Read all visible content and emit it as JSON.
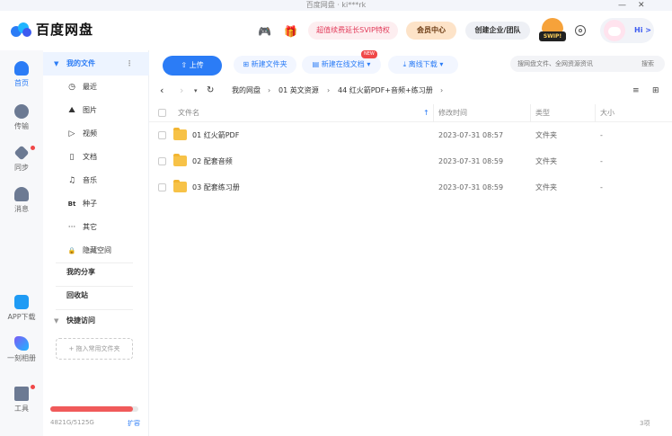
{
  "window": {
    "title": "百度网盘 · ki***rk",
    "minimize": "—",
    "close": "✕"
  },
  "header": {
    "brand": "百度网盘",
    "svip_label": "超值续费延长SVIP特权",
    "vip_center": "会员中心",
    "enterprise": "创建企业/团队",
    "badge": "SWIP!",
    "greeting": "Hi >"
  },
  "left_nav": [
    {
      "label": "首页"
    },
    {
      "label": "传输"
    },
    {
      "label": "同步"
    },
    {
      "label": "消息"
    },
    {
      "label": "APP下载"
    },
    {
      "label": "一刻相册"
    },
    {
      "label": "工具"
    }
  ],
  "tree": {
    "root_label": "我的文件",
    "items": [
      {
        "icon": "◷",
        "label": "最近"
      },
      {
        "icon": "⛰",
        "label": "图片"
      },
      {
        "icon": "▷",
        "label": "视频"
      },
      {
        "icon": "▯",
        "label": "文档"
      },
      {
        "icon": "♫",
        "label": "音乐"
      },
      {
        "icon": "Bt",
        "label": "种子"
      },
      {
        "icon": "···",
        "label": "其它"
      },
      {
        "icon": "🔒",
        "label": "隐藏空间"
      }
    ],
    "my_share": "我的分享",
    "recycle": "回收站",
    "quick_access": "快捷访问",
    "add_folder": "+ 拖入常用文件夹"
  },
  "storage": {
    "text": "4821G/5125G",
    "expand": "扩容",
    "used_ratio": 0.94
  },
  "toolbar": {
    "upload": "上传",
    "new_folder": "新建文件夹",
    "new_online_doc": "新建在线文档",
    "new_badge": "NEW",
    "offline_download": "离线下载",
    "search_placeholder": "搜网盘文件、全网资源资讯",
    "search_btn": "搜索"
  },
  "breadcrumb": [
    "我的网盘",
    "01 英文资源",
    "44 红火箭PDF+音频+练习册"
  ],
  "table": {
    "headers": {
      "name": "文件名",
      "modified": "修改时间",
      "type": "类型",
      "size": "大小"
    },
    "rows": [
      {
        "name": "01 红火箭PDF",
        "modified": "2023-07-31 08:57",
        "type": "文件夹",
        "size": "-"
      },
      {
        "name": "02 配套音频",
        "modified": "2023-07-31 08:59",
        "type": "文件夹",
        "size": "-"
      },
      {
        "name": "03 配套练习册",
        "modified": "2023-07-31 08:59",
        "type": "文件夹",
        "size": "-"
      }
    ],
    "count": "3项"
  },
  "colors": {
    "accent": "#2b7cf6",
    "selected_bg": "#edf4ff",
    "folder": "#f7c247"
  }
}
